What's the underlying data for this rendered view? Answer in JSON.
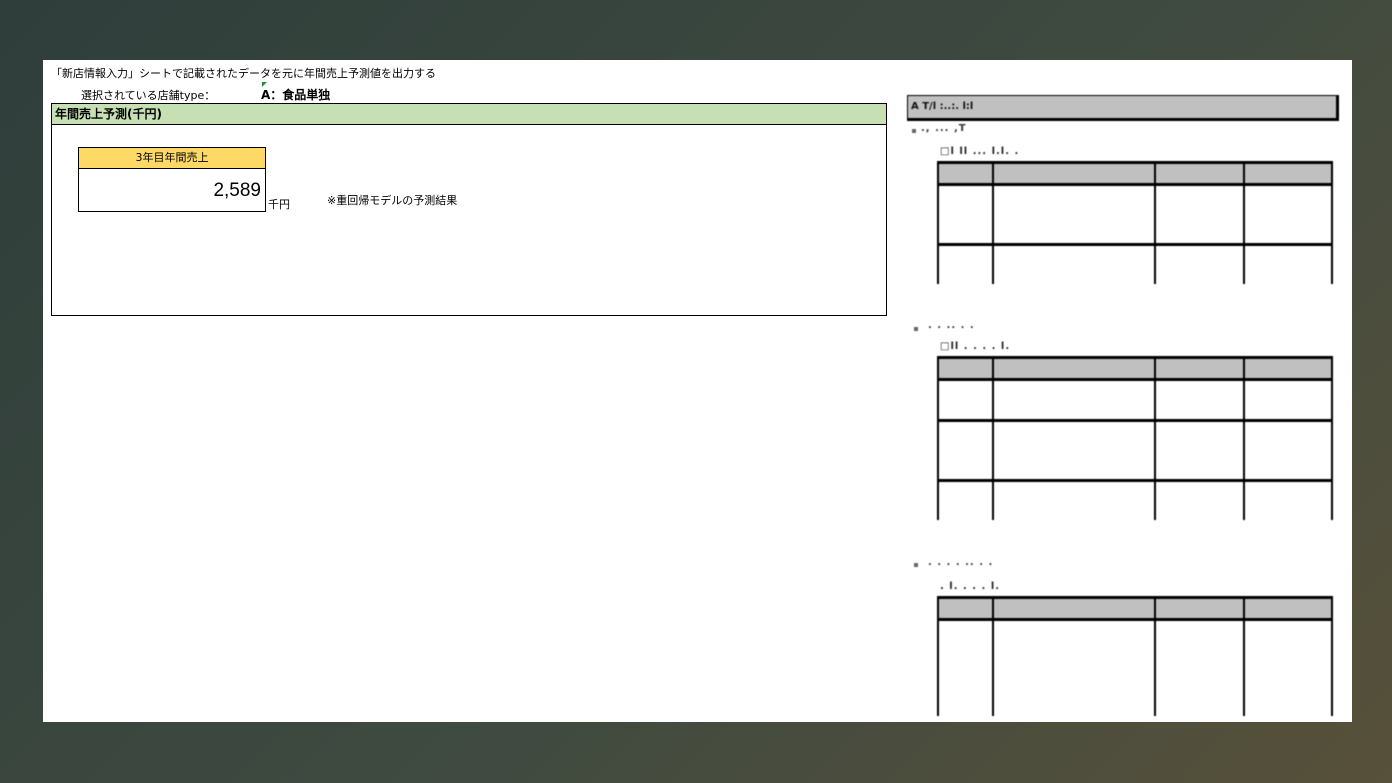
{
  "intro_text": "「新店情報入力」シートで記載されたデータを元に年間売上予測値を出力する",
  "selected_label": "選択されている店舗type：",
  "selected_value": "A：食品単独",
  "panel": {
    "title": "年間売上予測(千円)",
    "sales_label": "3年目年間売上",
    "sales_value": "2,589",
    "unit": "千円",
    "note": "※重回帰モデルの予測結果"
  },
  "right_report": {
    "header": "A  T/l  :..:.  l:l",
    "sections": [
      {
        "title": "., ... ,T",
        "subtitle": "□l ll ... l.l. .",
        "rows": [
          [
            "",
            "",
            "",
            ""
          ],
          [
            "",
            "",
            "",
            ""
          ],
          [
            "",
            "",
            "",
            ""
          ],
          [
            "",
            "",
            "",
            ""
          ],
          [
            "",
            "",
            "",
            ""
          ],
          [
            "",
            "",
            "",
            ""
          ]
        ]
      },
      {
        "title": ". . .. . .",
        "subtitle": "□ll . . . . l.",
        "rows": [
          [
            "",
            "",
            "",
            ""
          ],
          [
            "",
            "",
            "",
            ""
          ],
          [
            "",
            "",
            "",
            ""
          ],
          [
            "",
            "",
            "",
            ""
          ],
          [
            "",
            "",
            "",
            ""
          ],
          [
            "",
            "",
            "",
            ""
          ],
          [
            "",
            "",
            "",
            ""
          ],
          [
            "",
            "",
            "",
            ""
          ]
        ]
      },
      {
        "title": ". . . . .. . .",
        "subtitle": ". l. . . . l.",
        "rows": [
          [
            "",
            "",
            "",
            ""
          ],
          [
            "",
            "",
            "",
            ""
          ],
          [
            "",
            "",
            "",
            ""
          ],
          [
            "",
            "",
            "",
            ""
          ],
          [
            "",
            "",
            "",
            ""
          ],
          [
            "",
            "",
            "",
            ""
          ]
        ]
      }
    ]
  }
}
